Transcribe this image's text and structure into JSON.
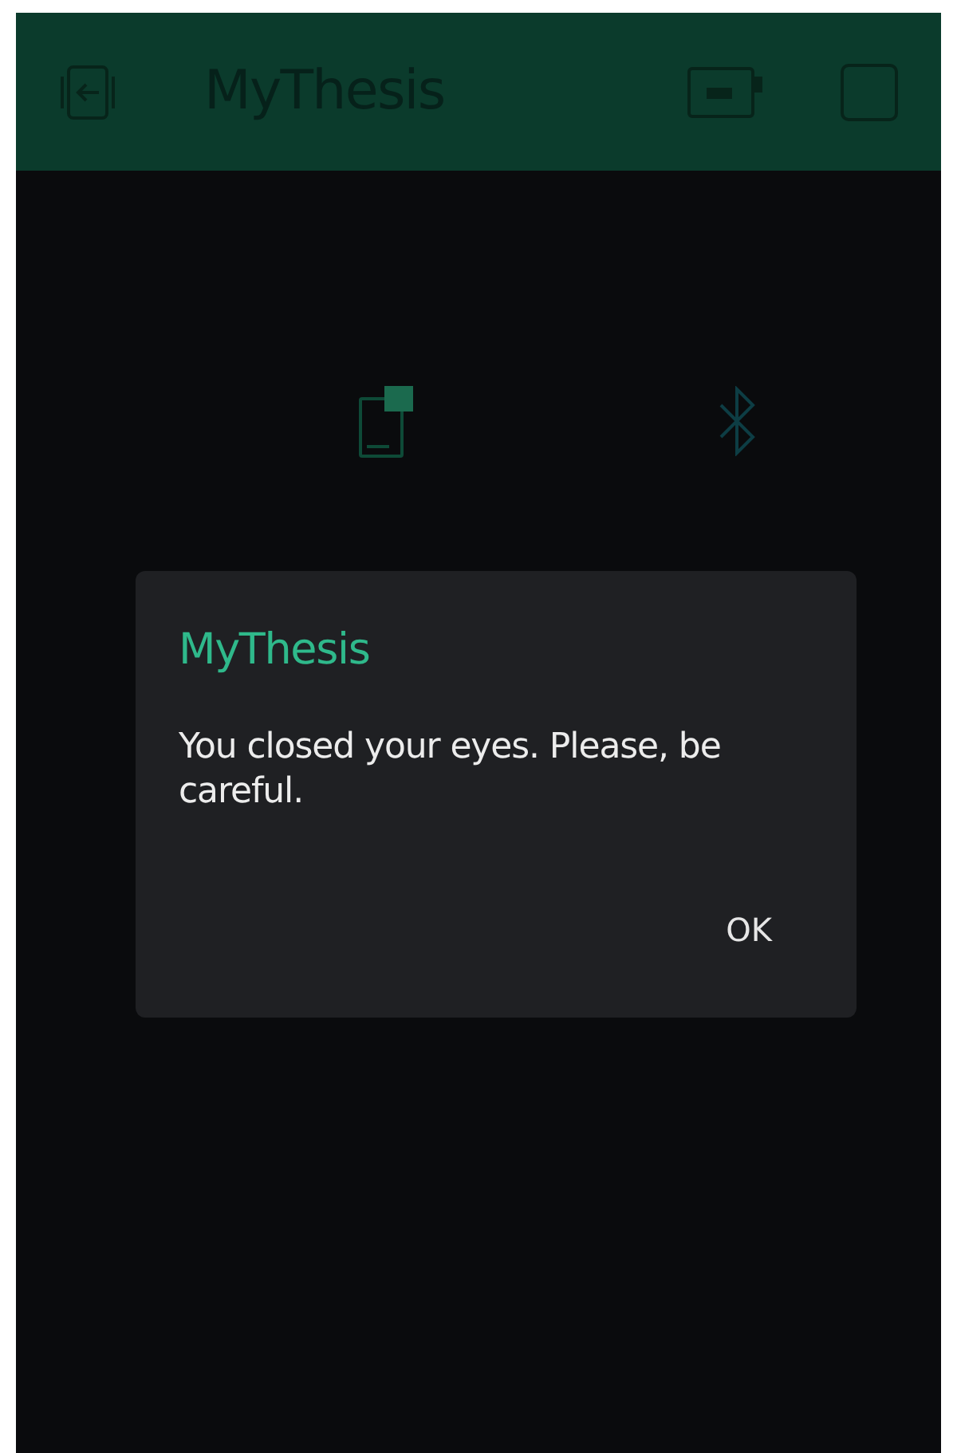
{
  "header": {
    "title": "MyThesis"
  },
  "dialog": {
    "title": "MyThesis",
    "message": "You closed your eyes. Please, be careful.",
    "buttons": [
      "OK"
    ]
  }
}
